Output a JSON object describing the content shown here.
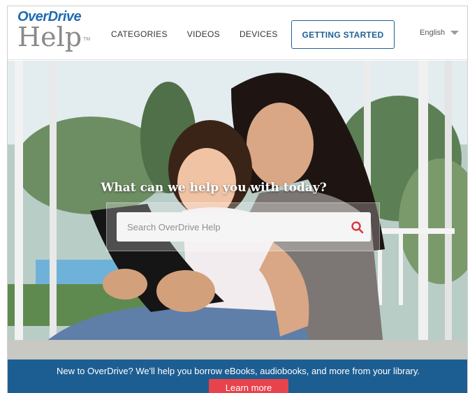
{
  "logo": {
    "brand": "OverDrive",
    "product": "Help",
    "tm": "TM"
  },
  "nav": {
    "items": [
      {
        "label": "CATEGORIES"
      },
      {
        "label": "VIDEOS"
      },
      {
        "label": "DEVICES"
      }
    ],
    "cta_label": "GETTING STARTED",
    "language": "English"
  },
  "hero": {
    "heading": "What can we help you with today?",
    "search_placeholder": "Search OverDrive Help",
    "search_value": ""
  },
  "banner": {
    "text": "New to OverDrive? We'll help you borrow eBooks, audiobooks, and more from your library.",
    "button_label": "Learn more"
  },
  "colors": {
    "brand_blue": "#1f6bb0",
    "banner_blue": "#1d5e92",
    "accent_red": "#e8434c",
    "search_icon": "#d9363e"
  },
  "icons": {
    "search": "search-icon",
    "language_caret": "chevron-down-icon"
  }
}
